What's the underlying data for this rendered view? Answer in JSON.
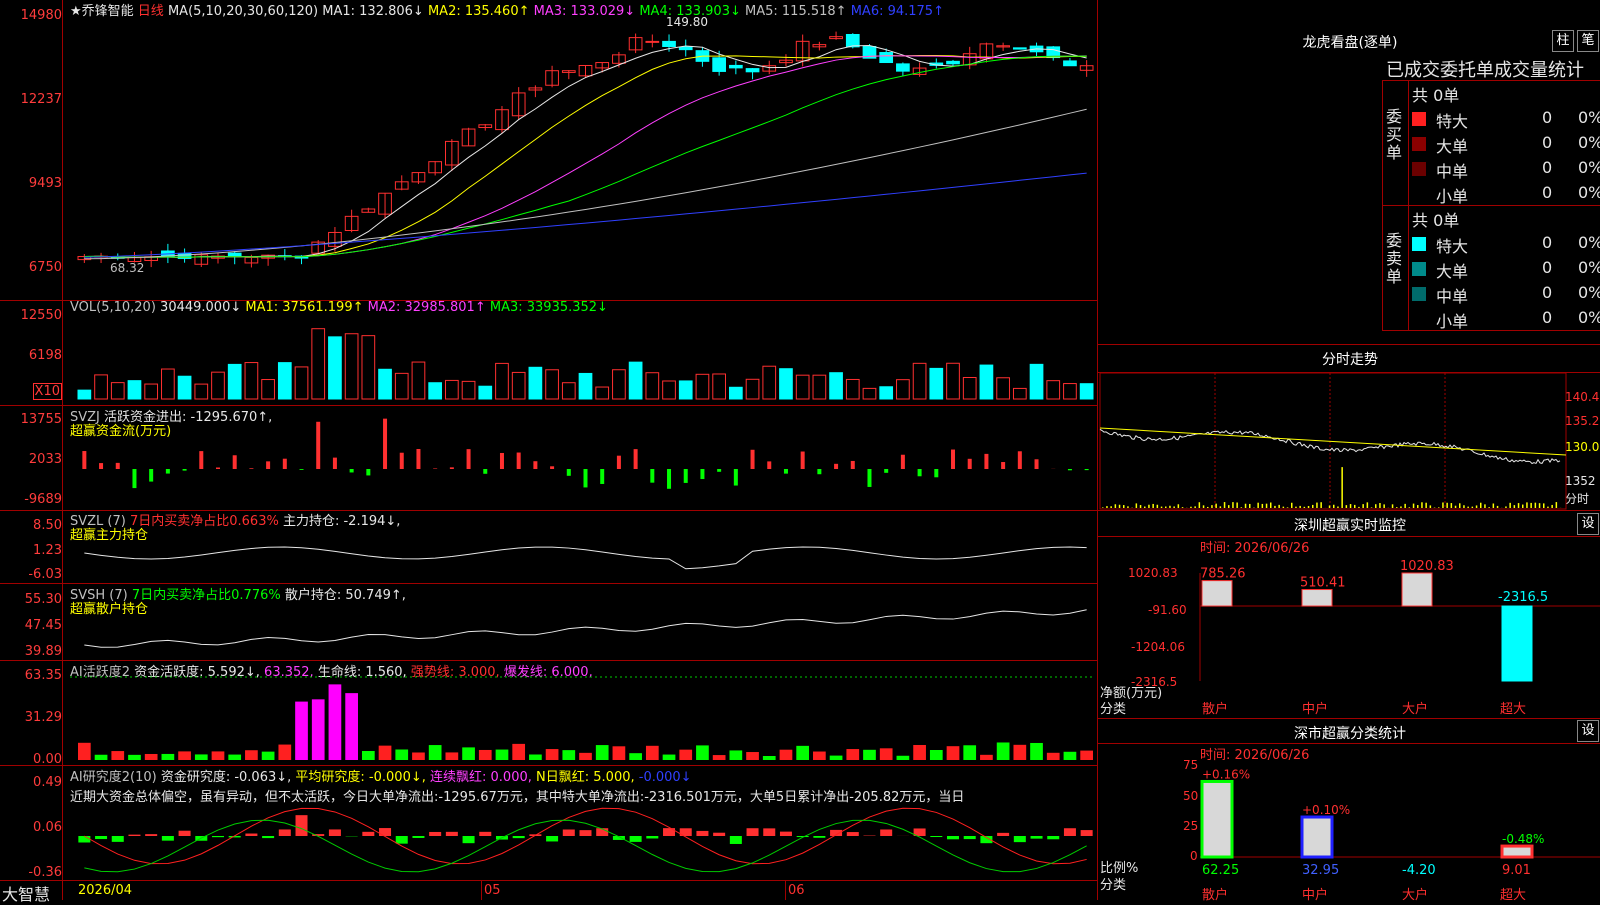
{
  "colors": {
    "up": "#ff3030",
    "down": "#00ffff",
    "grid": "#a00000",
    "ma1": "#e6e6e6",
    "ma2": "#ffff00",
    "ma3": "#ff40ff",
    "ma4": "#00ff00",
    "ma5": "#c0c0c0",
    "ma6": "#3040ff"
  },
  "main": {
    "stock": "★乔锋智能",
    "period": "日线",
    "ma_label": "MA(5,10,20,30,60,120)",
    "ma1": "MA1: 132.806↓",
    "ma2": "MA2: 135.460↑",
    "ma3": "MA3: 133.029↓",
    "ma4": "MA4: 133.903↓",
    "ma5": "MA5: 115.518↑",
    "ma6": "MA6: 94.175↑",
    "high_mark": "149.80",
    "low_mark": "68.32",
    "yticks": [
      "14980",
      "12237",
      "9493",
      "6750"
    ]
  },
  "vol": {
    "label": "VOL(5,10,20)",
    "value": "30449.000↓",
    "ma1": "MA1: 37561.199↑",
    "ma2": "MA2: 32985.801↑",
    "ma3": "MA3: 33935.352↓",
    "yticks": [
      "12550",
      "6198",
      "X10"
    ]
  },
  "svzj": {
    "label": "SVZJ",
    "desc": "活跃资金进出: -1295.670↑,",
    "sub": "超赢资金流(万元)",
    "yticks": [
      "13755",
      "2033",
      "-9689"
    ]
  },
  "svzl": {
    "label": "SVZL (7)",
    "desc": "7日内买卖净占比0.663%",
    "val": "主力持仓: -2.194↓,",
    "sub": "超赢主力持仓",
    "yticks": [
      "8.50",
      "1.23",
      "-6.03"
    ]
  },
  "svsh": {
    "label": "SVSH (7)",
    "desc": "7日内买卖净占比0.776%",
    "val": "散户持仓: 50.749↑,",
    "sub": "超赢散户持仓",
    "yticks": [
      "55.30",
      "47.45",
      "39.89"
    ]
  },
  "ai1": {
    "label": "AI活跃度2",
    "v1": "资金活跃度: 5.592↓,",
    "v2": "63.352,",
    "v3": "生命线: 1.560,",
    "v4": "强势线: 3.000,",
    "v5": "爆发线: 6.000,",
    "yticks": [
      "63.35",
      "31.29",
      "0.00"
    ]
  },
  "ai2": {
    "label": "AI研究度2(10)",
    "v1": "资金研究度: -0.063↓,",
    "v2": "平均研究度: -0.000↓,",
    "v3": "连续飘红: 0.000,",
    "v4": "N日飘红: 5.000,",
    "v5": "-0.000↓",
    "note": "近期大资金总体偏空，虽有异动，但不太活跃，今日大单净流出:-1295.67万元，其中特大单净流出:-2316.501万元，大单5日累计净出-205.82万元，当日",
    "yticks": [
      "0.49",
      "0.06",
      "-0.36"
    ]
  },
  "xaxis": {
    "brand": "大智慧",
    "date": "2026/04",
    "m05": "05",
    "m06": "06"
  },
  "lhb": {
    "title": "龙虎看盘(逐单)",
    "btn1": "柱",
    "btn2": "笔",
    "tabs": "已成交委托单成交量统计",
    "buy": {
      "side": "委买单",
      "total": "共 0单",
      "rows": [
        {
          "name": "特大",
          "v": "0",
          "p": "0%"
        },
        {
          "name": "大单",
          "v": "0",
          "p": "0%"
        },
        {
          "name": "中单",
          "v": "0",
          "p": "0%"
        },
        {
          "name": "小单",
          "v": "0",
          "p": "0%"
        }
      ]
    },
    "sell": {
      "side": "委卖单",
      "total": "共 0单",
      "rows": [
        {
          "name": "特大",
          "v": "0",
          "p": "0%"
        },
        {
          "name": "大单",
          "v": "0",
          "p": "0%"
        },
        {
          "name": "中单",
          "v": "0",
          "p": "0%"
        },
        {
          "name": "小单",
          "v": "0",
          "p": "0%"
        }
      ]
    }
  },
  "fs": {
    "title": "分时走势",
    "yticks": [
      "140.4",
      "135.2",
      "130.0",
      "1352"
    ],
    "xlab": "分时"
  },
  "szmon": {
    "title": "深圳超赢实时监控",
    "btn": "设",
    "time": "时间: 2026/06/26",
    "yticks": [
      "1020.83",
      "-91.60",
      "-1204.06",
      "-2316.5"
    ],
    "unit": "净额(万元)",
    "cat": "分类",
    "cats": [
      "散户",
      "中户",
      "大户",
      "超大"
    ]
  },
  "szcls": {
    "title": "深市超赢分类统计",
    "btn": "设",
    "time": "时间: 2026/06/26",
    "yticks": [
      "75",
      "50",
      "25",
      "0"
    ],
    "unit": "比例%",
    "cat": "分类",
    "cats": [
      "散户",
      "中户",
      "大户",
      "超大"
    ]
  },
  "chart_data": [
    {
      "type": "bar",
      "title": "深圳超赢实时监控",
      "ylabel": "净额(万元)",
      "xlabel": "分类",
      "categories": [
        "散户",
        "中户",
        "大户",
        "超大"
      ],
      "values": [
        785.26,
        510.41,
        1020.83,
        -2316.5
      ],
      "ylim": [
        -2316.5,
        1020.83
      ]
    },
    {
      "type": "bar",
      "title": "深市超赢分类统计",
      "ylabel": "比例%",
      "xlabel": "分类",
      "categories": [
        "散户",
        "中户",
        "大户",
        "超大"
      ],
      "values": [
        62.25,
        32.95,
        -4.2,
        9.01
      ],
      "changes": [
        "+0.16%",
        "+0.10%",
        "",
        "-0.48%"
      ],
      "ylim": [
        0,
        75
      ]
    }
  ]
}
